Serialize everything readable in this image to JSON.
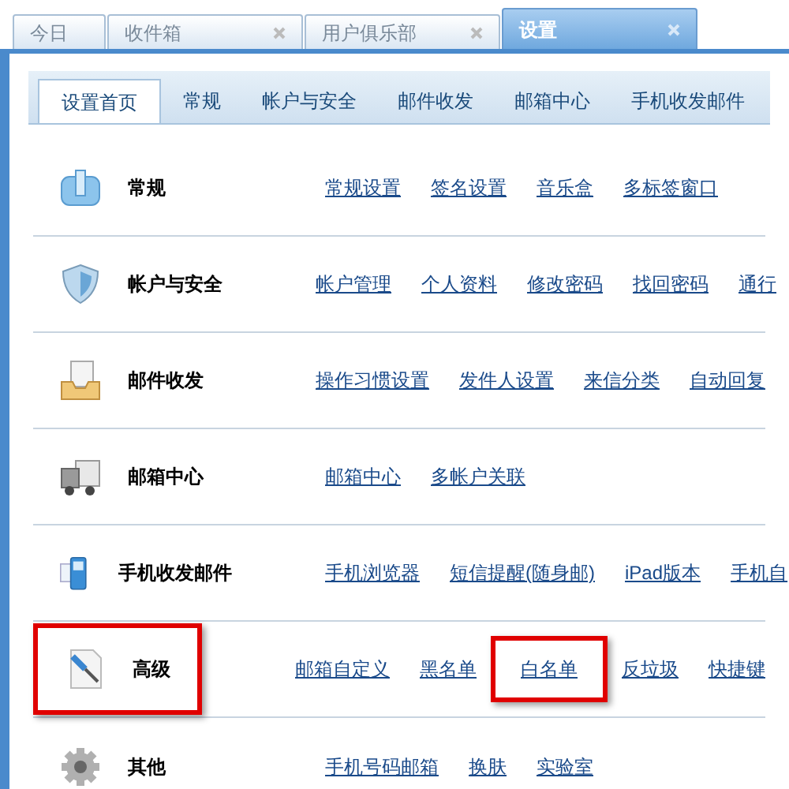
{
  "window_tabs": [
    {
      "label": "今日",
      "closable": false,
      "selected": false
    },
    {
      "label": "收件箱",
      "closable": true,
      "selected": false
    },
    {
      "label": "用户俱乐部",
      "closable": true,
      "selected": false
    },
    {
      "label": "设置",
      "closable": true,
      "selected": true
    }
  ],
  "settings_tabs": [
    {
      "label": "设置首页",
      "selected": true
    },
    {
      "label": "常规",
      "selected": false
    },
    {
      "label": "帐户与安全",
      "selected": false
    },
    {
      "label": "邮件收发",
      "selected": false
    },
    {
      "label": "邮箱中心",
      "selected": false
    },
    {
      "label": "手机收发邮件",
      "selected": false
    }
  ],
  "sections": [
    {
      "kind": "mailbox",
      "title": "常规",
      "highlighted": false,
      "links": [
        {
          "label": "常规设置",
          "highlighted": false
        },
        {
          "label": "签名设置",
          "highlighted": false
        },
        {
          "label": "音乐盒",
          "highlighted": false
        },
        {
          "label": "多标签窗口",
          "highlighted": false
        }
      ]
    },
    {
      "kind": "shield",
      "title": "帐户与安全",
      "highlighted": false,
      "links": [
        {
          "label": "帐户管理",
          "highlighted": false
        },
        {
          "label": "个人资料",
          "highlighted": false
        },
        {
          "label": "修改密码",
          "highlighted": false
        },
        {
          "label": "找回密码",
          "highlighted": false
        },
        {
          "label": "通行",
          "highlighted": false
        }
      ]
    },
    {
      "kind": "tray",
      "title": "邮件收发",
      "highlighted": false,
      "links": [
        {
          "label": "操作习惯设置",
          "highlighted": false
        },
        {
          "label": "发件人设置",
          "highlighted": false
        },
        {
          "label": "来信分类",
          "highlighted": false
        },
        {
          "label": "自动回复",
          "highlighted": false
        }
      ]
    },
    {
      "kind": "truck",
      "title": "邮箱中心",
      "highlighted": false,
      "links": [
        {
          "label": "邮箱中心",
          "highlighted": false
        },
        {
          "label": "多帐户关联",
          "highlighted": false
        }
      ]
    },
    {
      "kind": "phone",
      "title": "手机收发邮件",
      "highlighted": false,
      "links": [
        {
          "label": "手机浏览器",
          "highlighted": false
        },
        {
          "label": "短信提醒(随身邮)",
          "highlighted": false
        },
        {
          "label": "iPad版本",
          "highlighted": false
        },
        {
          "label": "手机自",
          "highlighted": false
        }
      ]
    },
    {
      "kind": "screwdriver",
      "title": "高级",
      "highlighted": true,
      "links": [
        {
          "label": "邮箱自定义",
          "highlighted": false
        },
        {
          "label": "黑名单",
          "highlighted": false
        },
        {
          "label": "白名单",
          "highlighted": true
        },
        {
          "label": "反垃圾",
          "highlighted": false
        },
        {
          "label": "快捷键",
          "highlighted": false
        }
      ]
    },
    {
      "kind": "gear",
      "title": "其他",
      "highlighted": false,
      "links": [
        {
          "label": "手机号码邮箱",
          "highlighted": false
        },
        {
          "label": "换肤",
          "highlighted": false
        },
        {
          "label": "实验室",
          "highlighted": false
        }
      ]
    }
  ]
}
